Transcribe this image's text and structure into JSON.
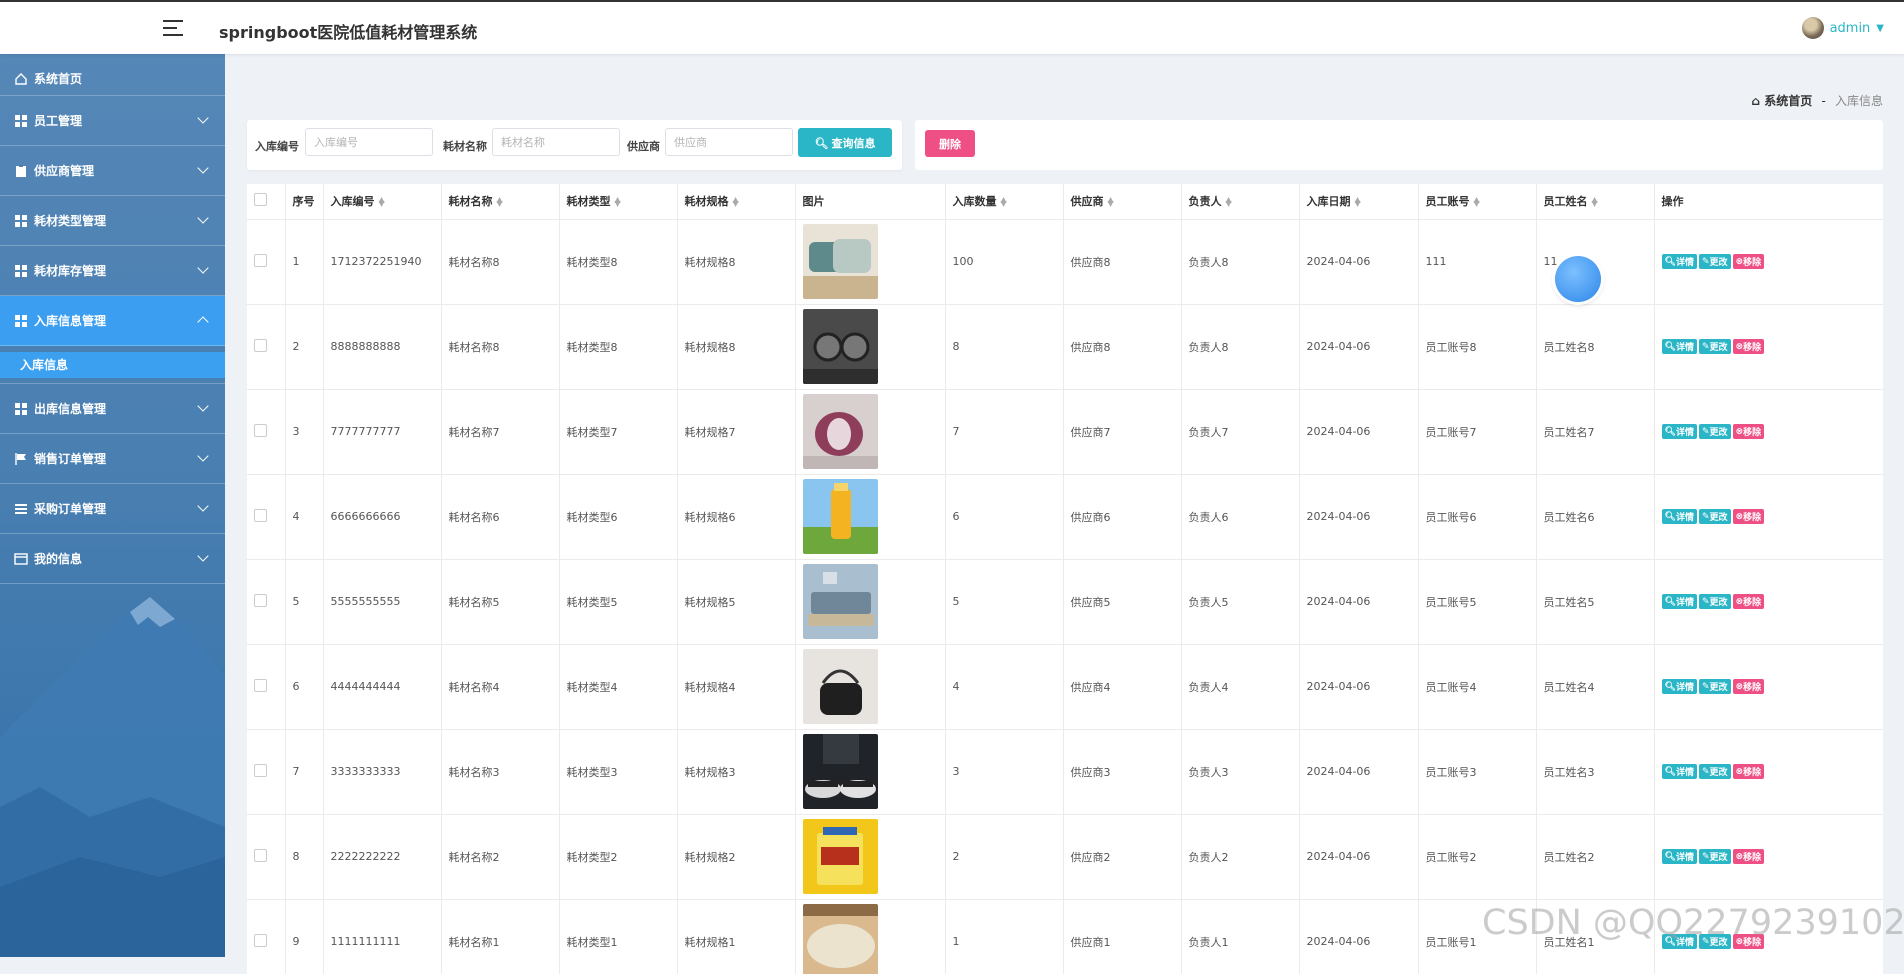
{
  "app": {
    "title": "springboot医院低值耗材管理系统"
  },
  "user": {
    "name": "admin"
  },
  "sidebar": {
    "items": [
      {
        "label": "系统首页",
        "icon": "home-icon"
      },
      {
        "label": "员工管理",
        "icon": "grid-icon"
      },
      {
        "label": "供应商管理",
        "icon": "clipboard-icon"
      },
      {
        "label": "耗材类型管理",
        "icon": "grid-icon"
      },
      {
        "label": "耗材库存管理",
        "icon": "grid-icon"
      },
      {
        "label": "入库信息管理",
        "icon": "grid-icon",
        "open": true,
        "children": [
          {
            "label": "入库信息"
          }
        ]
      },
      {
        "label": "出库信息管理",
        "icon": "grid-icon"
      },
      {
        "label": "销售订单管理",
        "icon": "flag-icon"
      },
      {
        "label": "采购订单管理",
        "icon": "list-icon"
      },
      {
        "label": "我的信息",
        "icon": "card-icon"
      }
    ]
  },
  "breadcrumb": {
    "home": "系统首页",
    "separator": "-",
    "current": "入库信息"
  },
  "search": {
    "fields": [
      {
        "label": "入库编号",
        "placeholder": "入库编号",
        "value": ""
      },
      {
        "label": "耗材名称",
        "placeholder": "耗材名称",
        "value": ""
      },
      {
        "label": "供应商",
        "placeholder": "供应商",
        "value": ""
      }
    ],
    "button_label": "查询信息"
  },
  "toolbar": {
    "delete_label": "删除"
  },
  "table": {
    "columns": [
      "序号",
      "入库编号",
      "耗材名称",
      "耗材类型",
      "耗材规格",
      "图片",
      "入库数量",
      "供应商",
      "负责人",
      "入库日期",
      "员工账号",
      "员工姓名",
      "操作"
    ],
    "rows": [
      {
        "idx": "1",
        "code": "1712372251940",
        "name": "耗材名称8",
        "type": "耗材类型8",
        "spec": "耗材规格8",
        "img": "pillow",
        "qty": "100",
        "supplier": "供应商8",
        "owner": "负责人8",
        "date": "2024-04-06",
        "account": "111",
        "emp": "11"
      },
      {
        "idx": "2",
        "code": "8888888888",
        "name": "耗材名称8",
        "type": "耗材类型8",
        "spec": "耗材规格8",
        "img": "glasses",
        "qty": "8",
        "supplier": "供应商8",
        "owner": "负责人8",
        "date": "2024-04-06",
        "account": "员工账号8",
        "emp": "员工姓名8"
      },
      {
        "idx": "3",
        "code": "7777777777",
        "name": "耗材名称7",
        "type": "耗材类型7",
        "spec": "耗材规格7",
        "img": "onion",
        "qty": "7",
        "supplier": "供应商7",
        "owner": "负责人7",
        "date": "2024-04-06",
        "account": "员工账号7",
        "emp": "员工姓名7"
      },
      {
        "idx": "4",
        "code": "6666666666",
        "name": "耗材名称6",
        "type": "耗材类型6",
        "spec": "耗材规格6",
        "img": "juice",
        "qty": "6",
        "supplier": "供应商6",
        "owner": "负责人6",
        "date": "2024-04-06",
        "account": "员工账号6",
        "emp": "员工姓名6"
      },
      {
        "idx": "5",
        "code": "5555555555",
        "name": "耗材名称5",
        "type": "耗材类型5",
        "spec": "耗材规格5",
        "img": "sofa",
        "qty": "5",
        "supplier": "供应商5",
        "owner": "负责人5",
        "date": "2024-04-06",
        "account": "员工账号5",
        "emp": "员工姓名5"
      },
      {
        "idx": "6",
        "code": "4444444444",
        "name": "耗材名称4",
        "type": "耗材类型4",
        "spec": "耗材规格4",
        "img": "bag",
        "qty": "4",
        "supplier": "供应商4",
        "owner": "负责人4",
        "date": "2024-04-06",
        "account": "员工账号4",
        "emp": "员工姓名4"
      },
      {
        "idx": "7",
        "code": "3333333333",
        "name": "耗材名称3",
        "type": "耗材类型3",
        "spec": "耗材规格3",
        "img": "shoes",
        "qty": "3",
        "supplier": "供应商3",
        "owner": "负责人3",
        "date": "2024-04-06",
        "account": "员工账号3",
        "emp": "员工姓名3"
      },
      {
        "idx": "8",
        "code": "2222222222",
        "name": "耗材名称2",
        "type": "耗材类型2",
        "spec": "耗材规格2",
        "img": "snack",
        "qty": "2",
        "supplier": "供应商2",
        "owner": "负责人2",
        "date": "2024-04-06",
        "account": "员工账号2",
        "emp": "员工姓名2"
      },
      {
        "idx": "9",
        "code": "1111111111",
        "name": "耗材名称1",
        "type": "耗材类型1",
        "spec": "耗材规格1",
        "img": "rice",
        "qty": "1",
        "supplier": "供应商1",
        "owner": "负责人1",
        "date": "2024-04-06",
        "account": "员工账号1",
        "emp": "员工姓名1"
      }
    ],
    "actions": {
      "detail": "详情",
      "edit": "更改",
      "remove": "移除"
    }
  },
  "watermark": "CSDN @QQ2279239102",
  "colors": {
    "primary": "#2bb6c7",
    "danger": "#ee4f84",
    "sidebar_active": "#3c9ef0"
  }
}
